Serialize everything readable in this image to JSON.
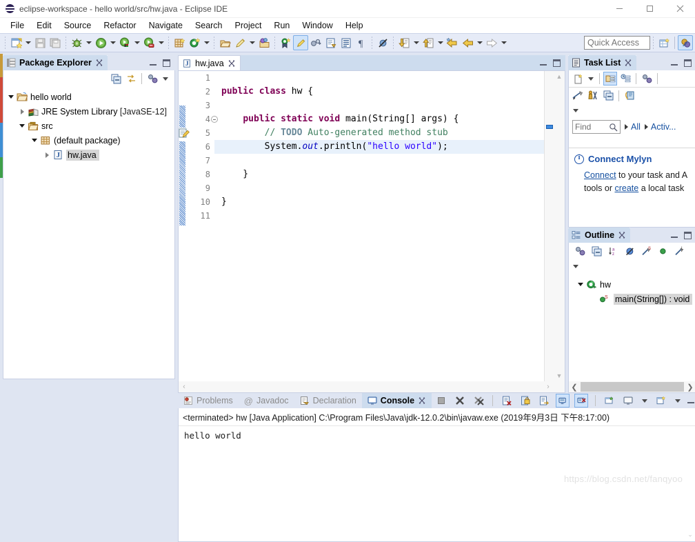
{
  "window": {
    "title": "eclipse-workspace - hello world/src/hw.java - Eclipse IDE",
    "logo_icon": "eclipse-logo",
    "minimize_label": "—",
    "maximize_label": "▢",
    "close_label": "✕"
  },
  "menubar": {
    "items": [
      {
        "label": "File"
      },
      {
        "label": "Edit"
      },
      {
        "label": "Source"
      },
      {
        "label": "Refactor"
      },
      {
        "label": "Navigate"
      },
      {
        "label": "Search"
      },
      {
        "label": "Project"
      },
      {
        "label": "Run"
      },
      {
        "label": "Window"
      },
      {
        "label": "Help"
      }
    ]
  },
  "toolbar": {
    "icons": [
      {
        "name": "new-wizard-icon",
        "dropdown": true
      },
      {
        "name": "save-icon",
        "dropdown": false
      },
      {
        "name": "save-all-icon",
        "dropdown": false
      },
      {
        "name": "debug-icon",
        "dropdown": true
      },
      {
        "name": "run-icon",
        "dropdown": true
      },
      {
        "name": "run-external-tools-icon",
        "dropdown": true
      },
      {
        "name": "coverage-icon",
        "dropdown": true
      },
      {
        "name": "new-java-package-icon",
        "dropdown": false
      },
      {
        "name": "new-java-class-icon",
        "dropdown": true
      },
      {
        "name": "open-type-icon",
        "dropdown": false
      },
      {
        "name": "search-icon",
        "dropdown": true
      },
      {
        "name": "open-task-icon",
        "dropdown": false
      },
      {
        "name": "new-task-icon",
        "dropdown": false
      },
      {
        "name": "toggle-mylyn-icon",
        "dropdown": false
      },
      {
        "name": "link-editor-icon",
        "dropdown": false
      },
      {
        "name": "next-annotation-icon",
        "dropdown": false
      },
      {
        "name": "show-whitespace-icon",
        "dropdown": false
      },
      {
        "name": "pilcrow-icon",
        "dropdown": false
      },
      {
        "name": "skip-breakpoints-icon",
        "dropdown": false
      },
      {
        "name": "next-edit-icon",
        "dropdown": true
      },
      {
        "name": "previous-edit-icon",
        "dropdown": true
      },
      {
        "name": "back-icon",
        "dropdown": false
      },
      {
        "name": "back-history-icon",
        "dropdown": true
      },
      {
        "name": "forward-icon",
        "dropdown": true
      }
    ],
    "quick_access_placeholder": "Quick Access",
    "perspective_icons": [
      {
        "name": "open-perspective-icon"
      },
      {
        "name": "java-perspective-icon"
      }
    ]
  },
  "package_explorer": {
    "tab_label": "Package Explorer",
    "tab_icon": "package-explorer-icon",
    "close_icon": "close-icon",
    "toolbar": [
      {
        "name": "collapse-all-icon"
      },
      {
        "name": "link-with-editor-icon"
      },
      {
        "name": "view-menu-icon"
      },
      {
        "name": "view-menu-chevron-icon"
      }
    ],
    "tree": [
      {
        "label": "hello world",
        "icon": "java-project-icon",
        "indent": 0,
        "twisty": "open",
        "selected": false,
        "suffix": ""
      },
      {
        "label": "JRE System Library ",
        "icon": "jre-library-icon",
        "indent": 1,
        "twisty": "closed",
        "selected": false,
        "suffix": "[JavaSE-12]"
      },
      {
        "label": "src",
        "icon": "source-folder-icon",
        "indent": 1,
        "twisty": "open",
        "selected": false,
        "suffix": ""
      },
      {
        "label": "(default package)",
        "icon": "package-icon",
        "indent": 2,
        "twisty": "open",
        "selected": false,
        "suffix": ""
      },
      {
        "label": "hw.java",
        "icon": "java-file-icon",
        "indent": 3,
        "twisty": "closed",
        "selected": true,
        "suffix": ""
      }
    ]
  },
  "editor": {
    "tab_label": "hw.java",
    "tab_icon": "java-file-icon",
    "close_icon": "close-icon",
    "line_numbers": [
      "1",
      "2",
      "3",
      "4",
      "5",
      "6",
      "7",
      "8",
      "9",
      "10",
      "11"
    ],
    "fold_marker_line": 4,
    "highlight_line": 6,
    "marker_icon_line": 5,
    "marker_icon": "quickfix-todo-icon",
    "lines": [
      {
        "n": 1,
        "tokens": []
      },
      {
        "n": 2,
        "tokens": [
          {
            "t": "kw",
            "v": "public"
          },
          {
            "t": "pl",
            "v": " "
          },
          {
            "t": "kw",
            "v": "class"
          },
          {
            "t": "pl",
            "v": " hw {"
          }
        ]
      },
      {
        "n": 3,
        "tokens": []
      },
      {
        "n": 4,
        "tokens": [
          {
            "t": "pl",
            "v": "    "
          },
          {
            "t": "kw",
            "v": "public"
          },
          {
            "t": "pl",
            "v": " "
          },
          {
            "t": "kw",
            "v": "static"
          },
          {
            "t": "pl",
            "v": " "
          },
          {
            "t": "kw",
            "v": "void"
          },
          {
            "t": "pl",
            "v": " main(String[] args) {"
          }
        ]
      },
      {
        "n": 5,
        "tokens": [
          {
            "t": "pl",
            "v": "        "
          },
          {
            "t": "cm",
            "v": "// "
          },
          {
            "t": "tdo",
            "v": "TODO"
          },
          {
            "t": "cm",
            "v": " Auto-generated method stub"
          }
        ]
      },
      {
        "n": 6,
        "tokens": [
          {
            "t": "pl",
            "v": "        System."
          },
          {
            "t": "fld",
            "v": "out"
          },
          {
            "t": "pl",
            "v": ".println("
          },
          {
            "t": "st",
            "v": "\"hello world\""
          },
          {
            "t": "pl",
            "v": ");"
          }
        ]
      },
      {
        "n": 7,
        "tokens": []
      },
      {
        "n": 8,
        "tokens": [
          {
            "t": "pl",
            "v": "    }"
          }
        ]
      },
      {
        "n": 9,
        "tokens": []
      },
      {
        "n": 10,
        "tokens": [
          {
            "t": "pl",
            "v": "}"
          }
        ]
      },
      {
        "n": 11,
        "tokens": []
      }
    ]
  },
  "task_list": {
    "tab_label": "Task List",
    "tab_icon": "task-list-icon",
    "close_icon": "close-icon",
    "toolbar_row1": [
      {
        "name": "new-task-icon"
      },
      {
        "name": "new-task-chevron-icon"
      },
      {
        "name": "categorized-presentation-icon"
      },
      {
        "name": "scheduled-presentation-icon"
      },
      {
        "name": "synchronize-changed-icon"
      }
    ],
    "toolbar_row2": [
      {
        "name": "focus-on-workweek-icon"
      },
      {
        "name": "show-all-tasks-icon"
      },
      {
        "name": "collapse-all-icon"
      },
      {
        "name": "restore-tasks-icon"
      }
    ],
    "toolbar_row3": [
      {
        "name": "view-menu-chevron-icon"
      }
    ],
    "find_placeholder": "Find",
    "find_icon": "search-icon",
    "filters": [
      {
        "label": "All"
      },
      {
        "label": "Activ..."
      }
    ],
    "notice": {
      "info_icon": "info-icon",
      "title": "Connect Mylyn",
      "line1_link": "Connect",
      "line1_rest": " to your task and A",
      "line2_pre": "tools or ",
      "line2_link": "create",
      "line2_rest": " a local task"
    }
  },
  "outline": {
    "tab_label": "Outline",
    "tab_icon": "outline-icon",
    "close_icon": "close-icon",
    "toolbar": [
      {
        "name": "focus-on-active-task-icon"
      },
      {
        "name": "collapse-all-icon"
      },
      {
        "name": "sort-alphabetically-icon"
      },
      {
        "name": "hide-fields-icon"
      },
      {
        "name": "hide-static-members-icon"
      },
      {
        "name": "hide-non-public-icon"
      },
      {
        "name": "hide-local-types-icon"
      },
      {
        "name": "view-menu-chevron-icon"
      }
    ],
    "tree": [
      {
        "label": "hw",
        "icon": "java-class-icon",
        "indent": 0,
        "twisty": "open",
        "selected": false
      },
      {
        "label": "main(String[]) : void",
        "icon": "public-static-method-icon",
        "indent": 2,
        "twisty": "none",
        "selected": true
      }
    ]
  },
  "console": {
    "tabs": [
      {
        "label": "Problems",
        "icon": "problems-icon",
        "active": false
      },
      {
        "label": "Javadoc",
        "icon": "javadoc-icon",
        "active": false
      },
      {
        "label": "Declaration",
        "icon": "declaration-icon",
        "active": false
      },
      {
        "label": "Console",
        "icon": "console-icon",
        "active": true
      }
    ],
    "close_icon": "close-icon",
    "toolbar": [
      {
        "name": "terminate-icon"
      },
      {
        "name": "remove-launch-icon"
      },
      {
        "name": "remove-all-terminated-icon"
      },
      {
        "name": "clear-console-icon"
      },
      {
        "name": "lock-scroll-icon"
      },
      {
        "name": "word-wrap-icon"
      },
      {
        "name": "show-console-on-output-icon",
        "selected": true
      },
      {
        "name": "show-console-on-error-icon",
        "selected": true
      },
      {
        "name": "pin-console-icon"
      },
      {
        "name": "display-selected-console-icon"
      },
      {
        "name": "display-selected-console-chevron-icon"
      },
      {
        "name": "open-console-icon"
      },
      {
        "name": "open-console-chevron-icon"
      }
    ],
    "header": "<terminated> hw [Java Application] C:\\Program Files\\Java\\jdk-12.0.2\\bin\\javaw.exe (2019年9月3日 下午8:17:00)",
    "output": "hello world"
  },
  "watermark": "https://blog.csdn.net/fanqyoo",
  "colors": {
    "window_bg": "#dfe5f2",
    "toolbar_bg": "#e6ebf7",
    "tab_active_bg": "#cddcee",
    "panel_border": "#c8d0e4",
    "keyword": "#7f0055",
    "string": "#2a00ff",
    "comment": "#3f7f5f",
    "todo": "#6a8a9a",
    "field": "#0000c0",
    "link": "#1550a0",
    "highlight_line": "#e8f1fb",
    "selection": "#d6d6d6"
  }
}
